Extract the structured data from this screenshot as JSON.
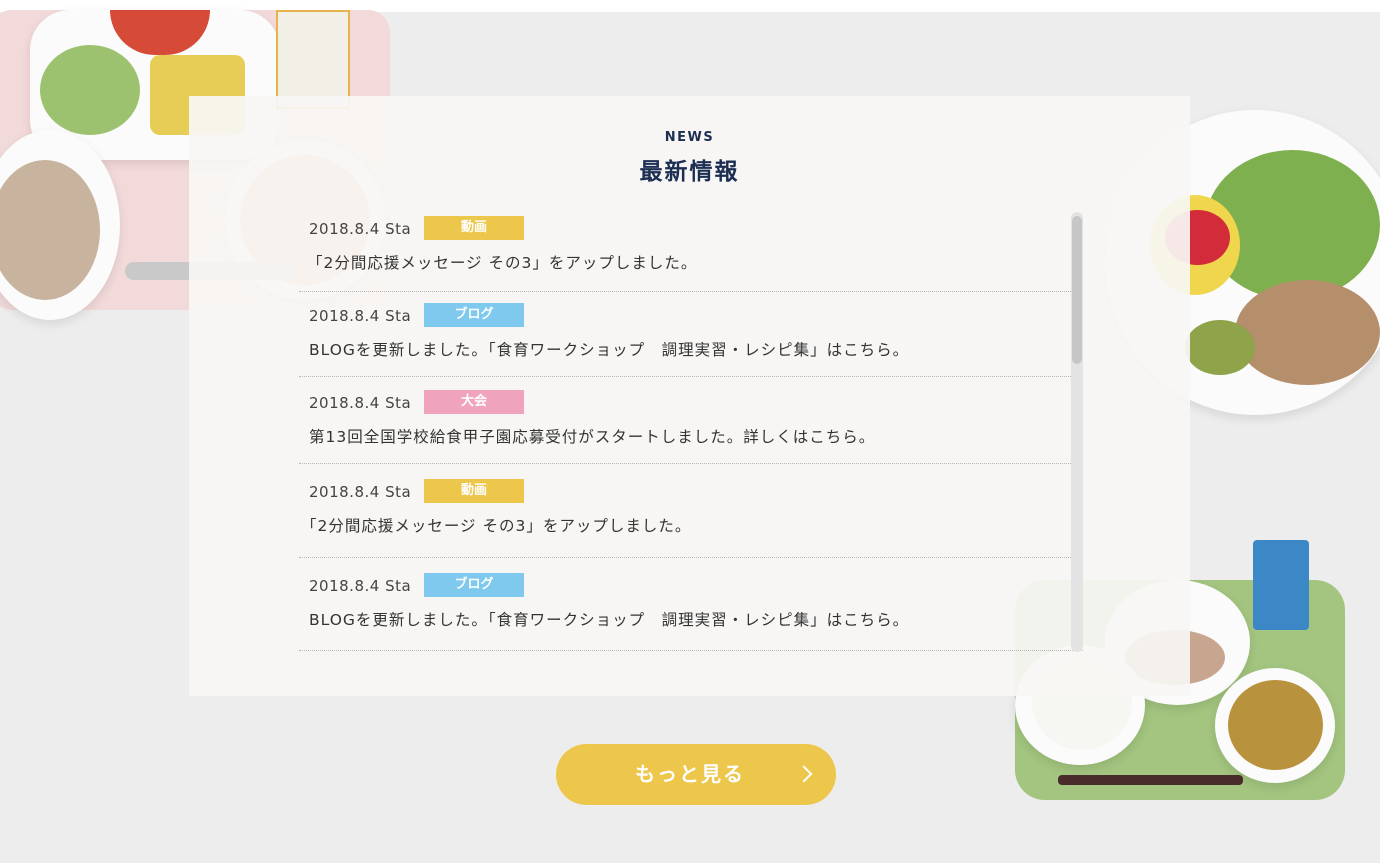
{
  "news": {
    "label": "NEWS",
    "title": "最新情報",
    "items": [
      {
        "date": "2018.8.4 Sta",
        "tag": "動画",
        "tag_color": "#ecc74b",
        "text": "「2分間応援メッセージ その3」をアップしました。"
      },
      {
        "date": "2018.8.4 Sta",
        "tag": "ブログ",
        "tag_color": "#7fc8ee",
        "text": "BLOGを更新しました。「食育ワークショップ　調理実習・レシピ集」はこちら。"
      },
      {
        "date": "2018.8.4 Sta",
        "tag": "大会",
        "tag_color": "#f0a3bd",
        "text": "第13回全国学校給食甲子園応募受付がスタートしました。詳しくはこちら。"
      },
      {
        "date": "2018.8.4 Sta",
        "tag": "動画",
        "tag_color": "#ecc74b",
        "text": "「2分間応援メッセージ その3」をアップしました。"
      },
      {
        "date": "2018.8.4 Sta",
        "tag": "ブログ",
        "tag_color": "#7fc8ee",
        "text": "BLOGを更新しました。「食育ワークショップ　調理実習・レシピ集」はこちら。"
      }
    ]
  },
  "more_button": {
    "label": "もっと見る",
    "icon": "chevron-right-icon"
  },
  "colors": {
    "accent": "#ecc74b",
    "heading": "#1c2e52",
    "background": "#ededed"
  }
}
